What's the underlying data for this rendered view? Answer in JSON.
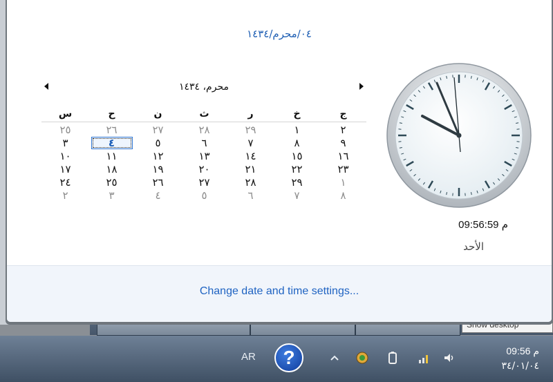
{
  "popup": {
    "date_header": "٠٤/محرم/١٤٣٤",
    "month_title": "محرم، ١٤٣٤",
    "weekdays": [
      "ج",
      "خ",
      "ر",
      "ث",
      "ن",
      "ح",
      "س"
    ],
    "weeks": [
      [
        "٢",
        "١",
        "٢٩",
        "٢٨",
        "٢٧",
        "٢٦",
        "٢٥"
      ],
      [
        "٩",
        "٨",
        "٧",
        "٦",
        "٥",
        "٤",
        "٣"
      ],
      [
        "١٦",
        "١٥",
        "١٤",
        "١٣",
        "١٢",
        "١١",
        "١٠"
      ],
      [
        "٢٣",
        "٢٢",
        "٢١",
        "٢٠",
        "١٩",
        "١٨",
        "١٧"
      ],
      [
        "١",
        "٢٩",
        "٢٨",
        "٢٧",
        "٢٦",
        "٢٥",
        "٢٤"
      ],
      [
        "٨",
        "٧",
        "٦",
        "٥",
        "٤",
        "٣",
        "٢"
      ]
    ],
    "time": "09:56:59 م",
    "day": "الأحد",
    "change_link": "Change date and time settings..."
  },
  "background": {
    "show_desktop": "Show desktop"
  },
  "taskbar": {
    "language": "AR",
    "help_glyph": "?",
    "tray_icons": [
      "chevron-up-icon",
      "network-globe-icon",
      "battery-icon",
      "signal-icon",
      "speaker-icon"
    ],
    "time": "09:56 م",
    "date": "٣٤/٠١/٠٤"
  },
  "colors": {
    "accent": "#1f63c2",
    "today_border": "#2f76d2"
  }
}
